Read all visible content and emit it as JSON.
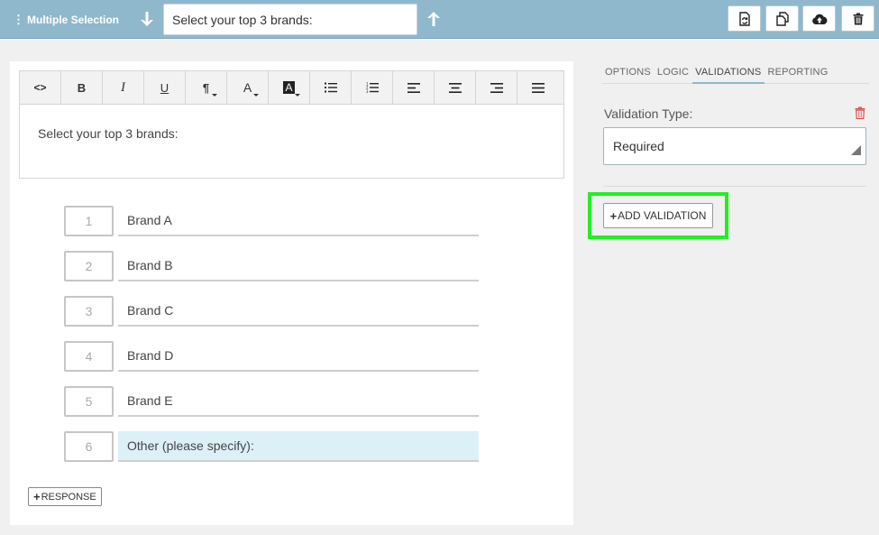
{
  "header": {
    "question_type": "Multiple Selection",
    "title_value": "Select your top 3 brands:",
    "icons": [
      "vertical-dots-icon",
      "arrow-down-icon",
      "arrow-up-icon",
      "page-refresh-icon",
      "copy-icon",
      "cloud-upload-icon",
      "trash-icon"
    ]
  },
  "editor": {
    "toolbar": [
      {
        "name": "code",
        "glyph": "<>"
      },
      {
        "name": "bold",
        "glyph": "B"
      },
      {
        "name": "italic",
        "glyph": "I"
      },
      {
        "name": "underline",
        "glyph": "U"
      },
      {
        "name": "paragraph",
        "glyph": "¶"
      },
      {
        "name": "font-color",
        "glyph": "A"
      },
      {
        "name": "highlight-color",
        "glyph": "A"
      },
      {
        "name": "bullet-list",
        "glyph": ""
      },
      {
        "name": "numbered-list",
        "glyph": ""
      },
      {
        "name": "align-left",
        "glyph": ""
      },
      {
        "name": "align-center",
        "glyph": ""
      },
      {
        "name": "align-right",
        "glyph": ""
      },
      {
        "name": "justify",
        "glyph": ""
      }
    ],
    "body_text": "Select your top 3 brands:"
  },
  "responses": [
    {
      "num": "1",
      "label": "Brand A"
    },
    {
      "num": "2",
      "label": "Brand B"
    },
    {
      "num": "3",
      "label": "Brand C"
    },
    {
      "num": "4",
      "label": "Brand D"
    },
    {
      "num": "5",
      "label": "Brand E"
    },
    {
      "num": "6",
      "label": "Other (please specify):"
    }
  ],
  "add_response_label": "RESPONSE",
  "panel": {
    "tabs": [
      "OPTIONS",
      "LOGIC",
      "VALIDATIONS",
      "REPORTING"
    ],
    "active_tab": "VALIDATIONS",
    "validation_type_label": "Validation Type:",
    "validation_type_value": "Required",
    "add_validation_label": "ADD VALIDATION"
  },
  "colors": {
    "topbar": "#8fb8cc",
    "highlight_box": "#22ee22",
    "delete_red": "#d9534f",
    "other_row_bg": "#dcf0f8"
  }
}
